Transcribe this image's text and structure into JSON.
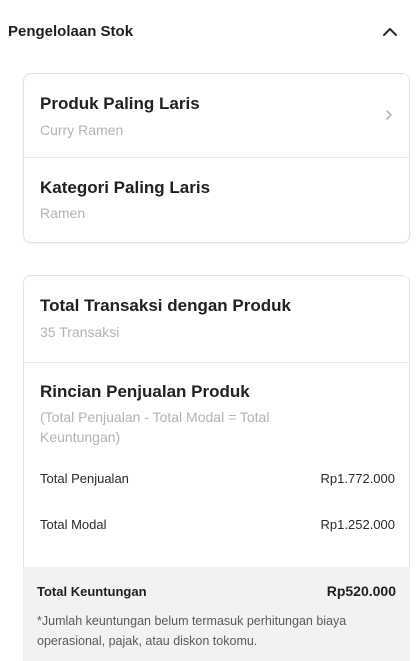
{
  "section": {
    "title": "Pengelolaan Stok",
    "collapse_icon": "chevron-up-icon"
  },
  "best_seller": {
    "product": {
      "title": "Produk Paling Laris",
      "value": "Curry Ramen",
      "icon": "chevron-right-icon"
    },
    "category": {
      "title": "Kategori Paling Laris",
      "value": "Ramen"
    }
  },
  "transactions": {
    "title": "Total Transaksi dengan Produk",
    "value": "35 Transaksi"
  },
  "sales_detail": {
    "title": "Rincian Penjualan Produk",
    "description": "(Total Penjualan - Total Modal = Total Keuntungan)",
    "rows": [
      {
        "label": "Total Penjualan",
        "value": "Rp1.772.000"
      },
      {
        "label": "Total Modal",
        "value": "Rp1.252.000"
      }
    ]
  },
  "profit": {
    "label": "Total Keuntungan",
    "value": "Rp520.000",
    "note": "*Jumlah keuntungan belum termasuk perhitungan biaya operasional, pajak, atau diskon tokomu."
  }
}
